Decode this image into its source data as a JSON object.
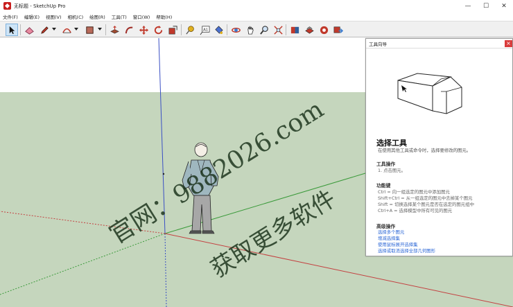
{
  "window": {
    "title": "无标题 - SketchUp Pro",
    "buttons": {
      "minimize": "—",
      "maximize": "☐",
      "close": "✕"
    }
  },
  "menu": [
    "文件(F)",
    "编辑(E)",
    "视图(V)",
    "相机(C)",
    "绘图(R)",
    "工具(T)",
    "窗口(W)",
    "帮助(H)"
  ],
  "toolbar": {
    "tools": [
      "select",
      "eraser",
      "line",
      "arc",
      "rectangle",
      "push-pull",
      "follow-me",
      "move",
      "rotate",
      "scale",
      "tape-measure",
      "text",
      "paint-bucket",
      "orbit",
      "pan",
      "zoom",
      "zoom-extents",
      "3d-warehouse",
      "extension-warehouse",
      "layout",
      "send-to-layout"
    ]
  },
  "scene": {
    "sky_color": "#ffffff",
    "ground_color": "#c5d6bd",
    "axis_colors": {
      "red": "#c44040",
      "green": "#3a9a3a",
      "blue": "#3a4fc4"
    }
  },
  "instructor": {
    "title": "工具向导",
    "close": "×",
    "heading": "选择工具",
    "subtitle": "在使用其他工具或命令时，选择要修改的图元。",
    "section_ops": "工具操作",
    "ops": [
      "1.   点击图元。"
    ],
    "section_keys": "功能键",
    "keys": [
      "Ctrl = 向一组选定的图元中添加图元",
      "Shift+Ctrl = 从一组选定的图元中去掉某个图元",
      "Shift = 切换选择某个图元是否在选定的图元组中",
      "Ctrl+A = 选择模型中所有可见的图元"
    ],
    "section_adv": "高级操作",
    "links": [
      "选择多个图元",
      "增减选择集",
      "使用鼠标展开选择集",
      "选择或取消选择全部几何图形"
    ]
  },
  "watermark": {
    "line1": "官网：9882026.com",
    "line2": "获取更多软件"
  }
}
